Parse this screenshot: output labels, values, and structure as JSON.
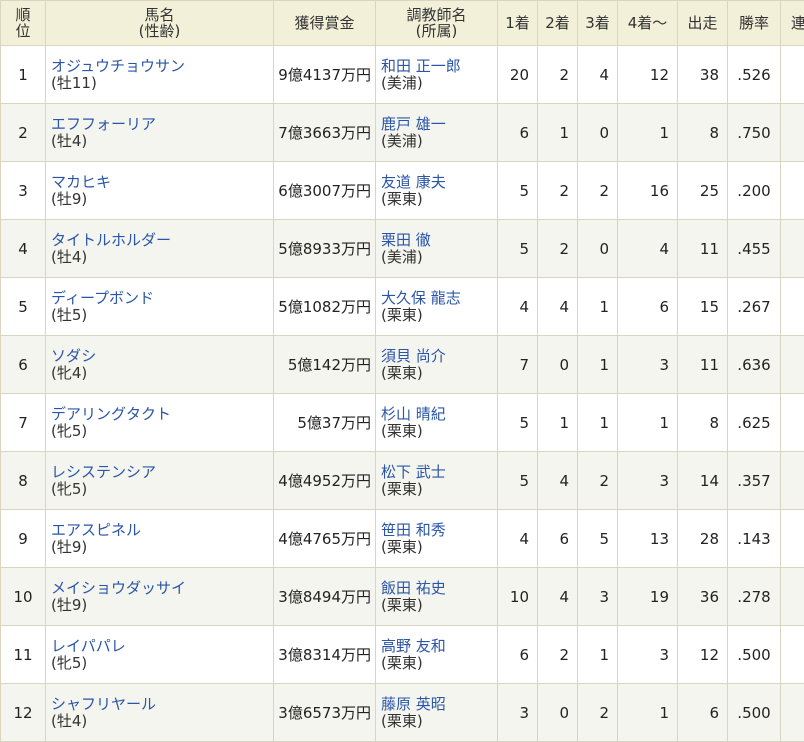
{
  "headers": {
    "rank_line1": "順",
    "rank_line2": "位",
    "horse_line1": "馬名",
    "horse_line2": "(性齢)",
    "prize": "獲得賞金",
    "trainer_line1": "調教師名",
    "trainer_line2": "(所属)",
    "first": "1着",
    "second": "2着",
    "third": "3着",
    "fourth_plus": "4着〜",
    "starts": "出走",
    "win_rate": "勝率",
    "place_rate_cut": "連"
  },
  "rows": [
    {
      "rank": "1",
      "name": "オジュウチョウサン",
      "sexage": "(牡11)",
      "prize": "9億4137万円",
      "trainer": "和田 正一郎",
      "affil": "(美浦)",
      "w1": "20",
      "w2": "2",
      "w3": "4",
      "w4": "12",
      "starts": "38",
      "rate": ".526"
    },
    {
      "rank": "2",
      "name": "エフフォーリア",
      "sexage": "(牡4)",
      "prize": "7億3663万円",
      "trainer": "鹿戸 雄一",
      "affil": "(美浦)",
      "w1": "6",
      "w2": "1",
      "w3": "0",
      "w4": "1",
      "starts": "8",
      "rate": ".750"
    },
    {
      "rank": "3",
      "name": "マカヒキ",
      "sexage": "(牡9)",
      "prize": "6億3007万円",
      "trainer": "友道 康夫",
      "affil": "(栗東)",
      "w1": "5",
      "w2": "2",
      "w3": "2",
      "w4": "16",
      "starts": "25",
      "rate": ".200"
    },
    {
      "rank": "4",
      "name": "タイトルホルダー",
      "sexage": "(牡4)",
      "prize": "5億8933万円",
      "trainer": "栗田 徹",
      "affil": "(美浦)",
      "w1": "5",
      "w2": "2",
      "w3": "0",
      "w4": "4",
      "starts": "11",
      "rate": ".455"
    },
    {
      "rank": "5",
      "name": "ディープボンド",
      "sexage": "(牡5)",
      "prize": "5億1082万円",
      "trainer": "大久保 龍志",
      "affil": "(栗東)",
      "w1": "4",
      "w2": "4",
      "w3": "1",
      "w4": "6",
      "starts": "15",
      "rate": ".267"
    },
    {
      "rank": "6",
      "name": "ソダシ",
      "sexage": "(牝4)",
      "prize": "5億142万円",
      "trainer": "須貝 尚介",
      "affil": "(栗東)",
      "w1": "7",
      "w2": "0",
      "w3": "1",
      "w4": "3",
      "starts": "11",
      "rate": ".636"
    },
    {
      "rank": "7",
      "name": "デアリングタクト",
      "sexage": "(牝5)",
      "prize": "5億37万円",
      "trainer": "杉山 晴紀",
      "affil": "(栗東)",
      "w1": "5",
      "w2": "1",
      "w3": "1",
      "w4": "1",
      "starts": "8",
      "rate": ".625"
    },
    {
      "rank": "8",
      "name": "レシステンシア",
      "sexage": "(牝5)",
      "prize": "4億4952万円",
      "trainer": "松下 武士",
      "affil": "(栗東)",
      "w1": "5",
      "w2": "4",
      "w3": "2",
      "w4": "3",
      "starts": "14",
      "rate": ".357"
    },
    {
      "rank": "9",
      "name": "エアスピネル",
      "sexage": "(牡9)",
      "prize": "4億4765万円",
      "trainer": "笹田 和秀",
      "affil": "(栗東)",
      "w1": "4",
      "w2": "6",
      "w3": "5",
      "w4": "13",
      "starts": "28",
      "rate": ".143"
    },
    {
      "rank": "10",
      "name": "メイショウダッサイ",
      "sexage": "(牡9)",
      "prize": "3億8494万円",
      "trainer": "飯田 祐史",
      "affil": "(栗東)",
      "w1": "10",
      "w2": "4",
      "w3": "3",
      "w4": "19",
      "starts": "36",
      "rate": ".278"
    },
    {
      "rank": "11",
      "name": "レイパパレ",
      "sexage": "(牝5)",
      "prize": "3億8314万円",
      "trainer": "高野 友和",
      "affil": "(栗東)",
      "w1": "6",
      "w2": "2",
      "w3": "1",
      "w4": "3",
      "starts": "12",
      "rate": ".500"
    },
    {
      "rank": "12",
      "name": "シャフリヤール",
      "sexage": "(牡4)",
      "prize": "3億6573万円",
      "trainer": "藤原 英昭",
      "affil": "(栗東)",
      "w1": "3",
      "w2": "0",
      "w3": "2",
      "w4": "1",
      "starts": "6",
      "rate": ".500"
    }
  ]
}
